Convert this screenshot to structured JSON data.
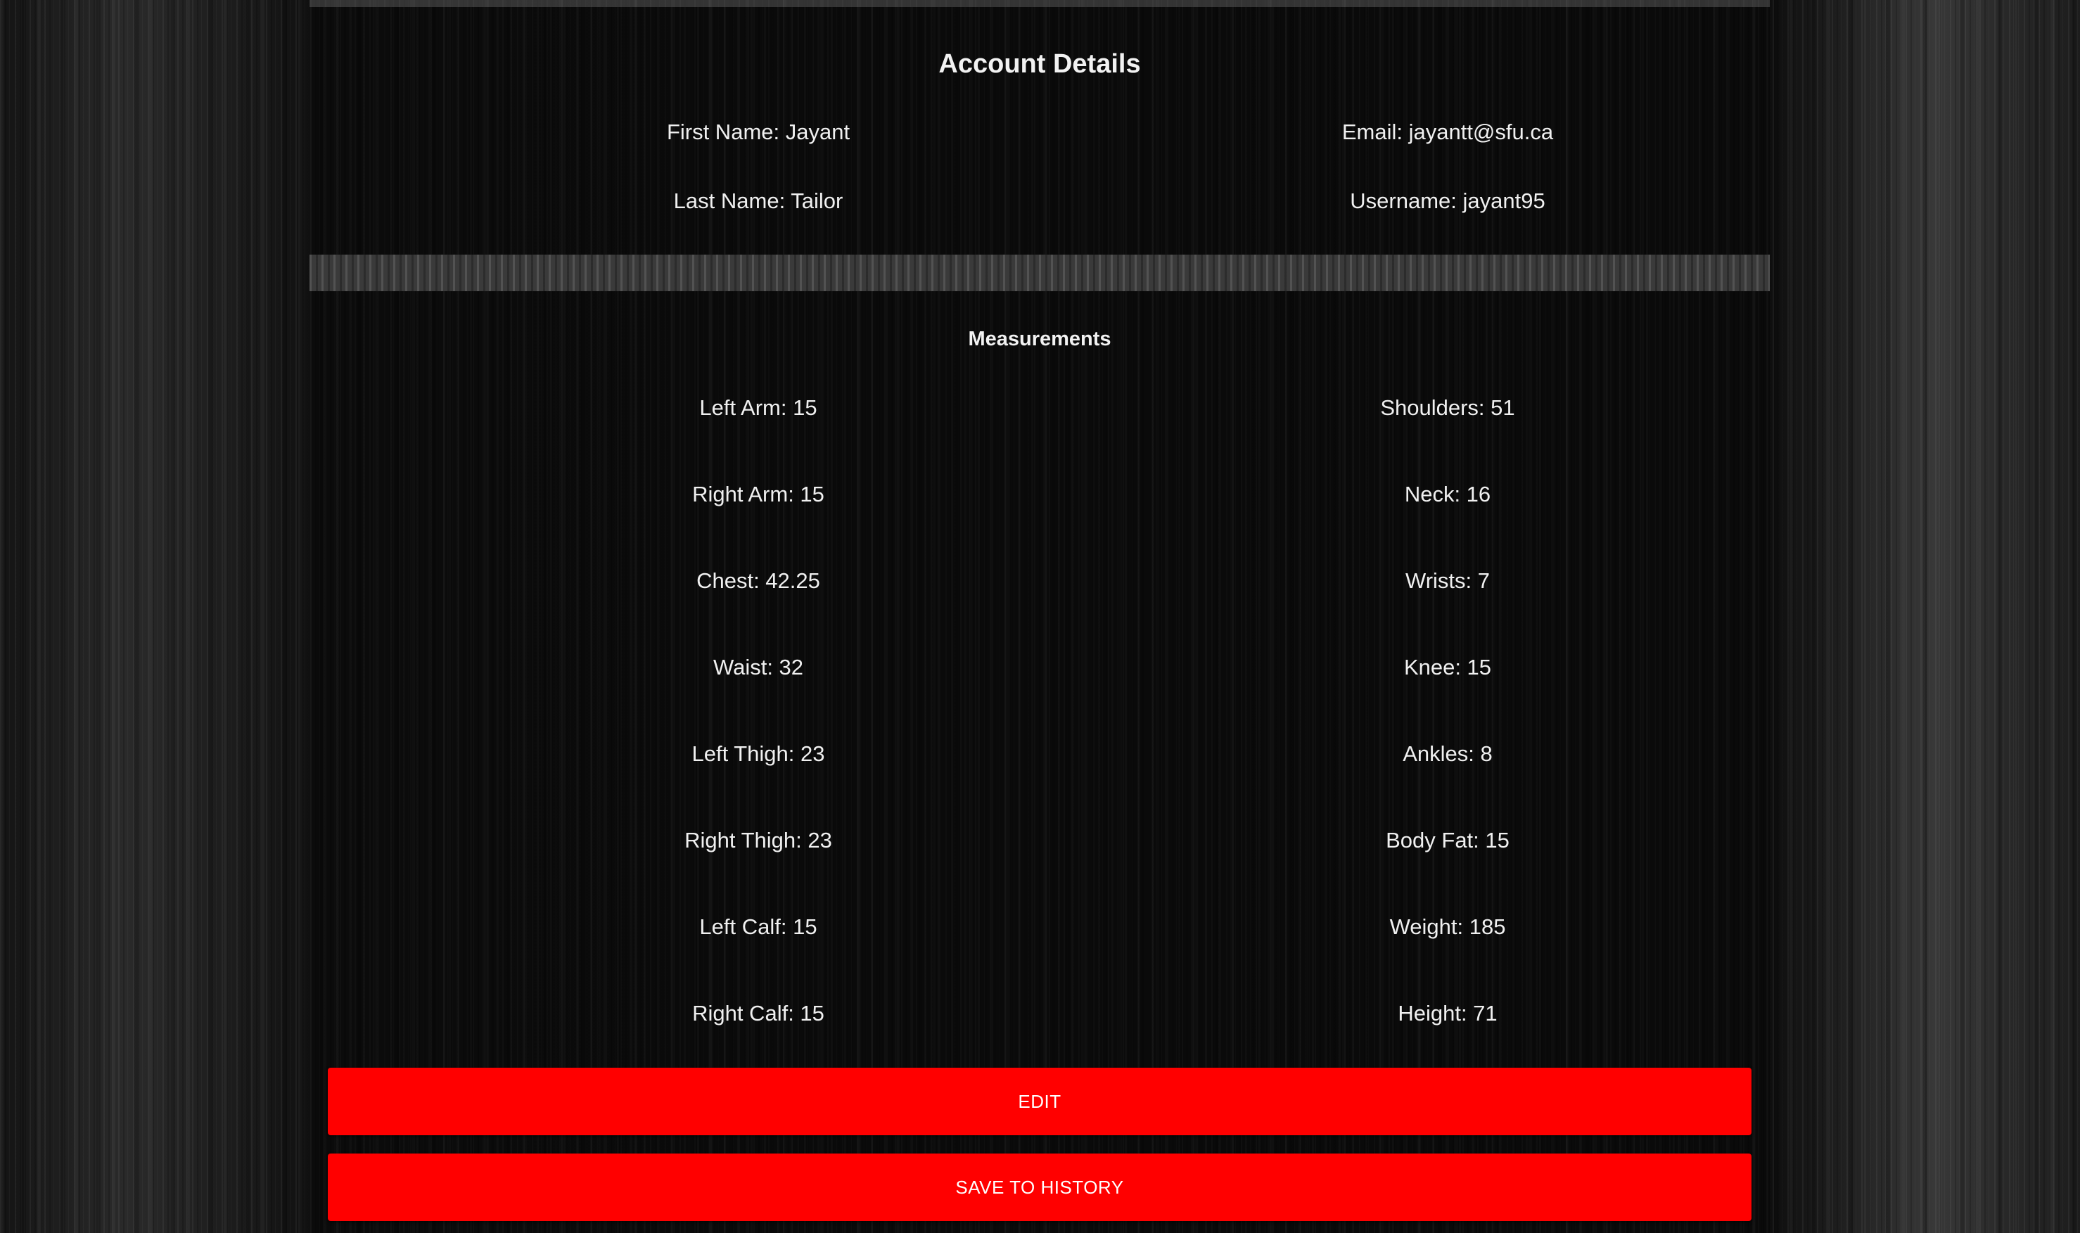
{
  "account": {
    "title": "Account Details",
    "first_name": "First Name: Jayant",
    "last_name": "Last Name: Tailor",
    "email": "Email: jayantt@sfu.ca",
    "username": "Username: jayant95"
  },
  "measurements": {
    "title": "Measurements",
    "left": [
      "Left Arm: 15",
      "Right Arm: 15",
      "Chest: 42.25",
      "Waist: 32",
      "Left Thigh: 23",
      "Right Thigh: 23",
      "Left Calf: 15",
      "Right Calf: 15"
    ],
    "right": [
      "Shoulders: 51",
      "Neck: 16",
      "Wrists: 7",
      "Knee: 15",
      "Ankles: 8",
      "Body Fat: 15",
      "Weight: 185",
      "Height: 71"
    ]
  },
  "buttons": {
    "edit_label": "EDIT",
    "save_label": "SAVE TO HISTORY"
  },
  "colors": {
    "button_bg": "#ff0000",
    "button_text": "#ffffff",
    "text": "#f0f0f0"
  }
}
